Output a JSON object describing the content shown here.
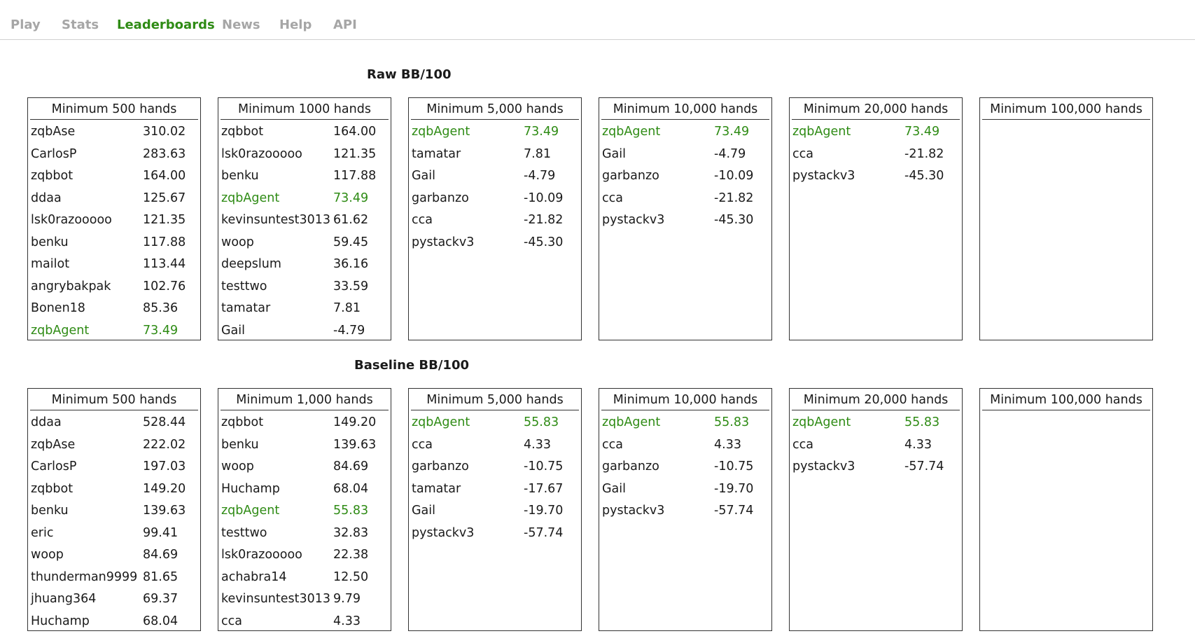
{
  "nav": {
    "items": [
      {
        "label": "Play",
        "active": false
      },
      {
        "label": "Stats",
        "active": false
      },
      {
        "label": "Leaderboards",
        "active": true
      },
      {
        "label": "News",
        "active": false
      },
      {
        "label": "Help",
        "active": false
      },
      {
        "label": "API",
        "active": false
      }
    ]
  },
  "colors": {
    "active_nav": "#2e8b14",
    "inactive_nav": "#a6a6a6",
    "highlight_row": "#2e8b14",
    "border": "#333333"
  },
  "highlighted_player": "zqbAgent",
  "sections": [
    {
      "title": "Raw BB/100",
      "boards": [
        {
          "title": "Minimum 500 hands",
          "rows": [
            {
              "name": "zqbAse",
              "value": "310.02"
            },
            {
              "name": "CarlosP",
              "value": "283.63"
            },
            {
              "name": "zqbbot",
              "value": "164.00"
            },
            {
              "name": "ddaa",
              "value": "125.67"
            },
            {
              "name": "lsk0razooooo",
              "value": "121.35"
            },
            {
              "name": "benku",
              "value": "117.88"
            },
            {
              "name": "mailot",
              "value": "113.44"
            },
            {
              "name": "angrybakpak",
              "value": "102.76"
            },
            {
              "name": "Bonen18",
              "value": "85.36"
            },
            {
              "name": "zqbAgent",
              "value": "73.49"
            }
          ]
        },
        {
          "title": "Minimum 1000 hands",
          "rows": [
            {
              "name": "zqbbot",
              "value": "164.00"
            },
            {
              "name": "lsk0razooooo",
              "value": "121.35"
            },
            {
              "name": "benku",
              "value": "117.88"
            },
            {
              "name": "zqbAgent",
              "value": "73.49"
            },
            {
              "name": "kevinsuntest3013",
              "value": "61.62"
            },
            {
              "name": "woop",
              "value": "59.45"
            },
            {
              "name": "deepslum",
              "value": "36.16"
            },
            {
              "name": "testtwo",
              "value": "33.59"
            },
            {
              "name": "tamatar",
              "value": "7.81"
            },
            {
              "name": "Gail",
              "value": "-4.79"
            }
          ]
        },
        {
          "title": "Minimum 5,000 hands",
          "rows": [
            {
              "name": "zqbAgent",
              "value": "73.49"
            },
            {
              "name": "tamatar",
              "value": "7.81"
            },
            {
              "name": "Gail",
              "value": "-4.79"
            },
            {
              "name": "garbanzo",
              "value": "-10.09"
            },
            {
              "name": "cca",
              "value": "-21.82"
            },
            {
              "name": "pystackv3",
              "value": "-45.30"
            }
          ]
        },
        {
          "title": "Minimum 10,000 hands",
          "rows": [
            {
              "name": "zqbAgent",
              "value": "73.49"
            },
            {
              "name": "Gail",
              "value": "-4.79"
            },
            {
              "name": "garbanzo",
              "value": "-10.09"
            },
            {
              "name": "cca",
              "value": "-21.82"
            },
            {
              "name": "pystackv3",
              "value": "-45.30"
            }
          ]
        },
        {
          "title": "Minimum 20,000 hands",
          "rows": [
            {
              "name": "zqbAgent",
              "value": "73.49"
            },
            {
              "name": "cca",
              "value": "-21.82"
            },
            {
              "name": "pystackv3",
              "value": "-45.30"
            }
          ]
        },
        {
          "title": "Minimum 100,000 hands",
          "rows": []
        }
      ]
    },
    {
      "title": "Baseline BB/100",
      "boards": [
        {
          "title": "Minimum 500 hands",
          "rows": [
            {
              "name": "ddaa",
              "value": "528.44"
            },
            {
              "name": "zqbAse",
              "value": "222.02"
            },
            {
              "name": "CarlosP",
              "value": "197.03"
            },
            {
              "name": "zqbbot",
              "value": "149.20"
            },
            {
              "name": "benku",
              "value": "139.63"
            },
            {
              "name": "eric",
              "value": "99.41"
            },
            {
              "name": "woop",
              "value": "84.69"
            },
            {
              "name": "thunderman9999",
              "value": "81.65"
            },
            {
              "name": "jhuang364",
              "value": "69.37"
            },
            {
              "name": "Huchamp",
              "value": "68.04"
            }
          ]
        },
        {
          "title": "Minimum 1,000 hands",
          "rows": [
            {
              "name": "zqbbot",
              "value": "149.20"
            },
            {
              "name": "benku",
              "value": "139.63"
            },
            {
              "name": "woop",
              "value": "84.69"
            },
            {
              "name": "Huchamp",
              "value": "68.04"
            },
            {
              "name": "zqbAgent",
              "value": "55.83"
            },
            {
              "name": "testtwo",
              "value": "32.83"
            },
            {
              "name": "lsk0razooooo",
              "value": "22.38"
            },
            {
              "name": "achabra14",
              "value": "12.50"
            },
            {
              "name": "kevinsuntest3013",
              "value": "9.79"
            },
            {
              "name": "cca",
              "value": "4.33"
            }
          ]
        },
        {
          "title": "Minimum 5,000 hands",
          "rows": [
            {
              "name": "zqbAgent",
              "value": "55.83"
            },
            {
              "name": "cca",
              "value": "4.33"
            },
            {
              "name": "garbanzo",
              "value": "-10.75"
            },
            {
              "name": "tamatar",
              "value": "-17.67"
            },
            {
              "name": "Gail",
              "value": "-19.70"
            },
            {
              "name": "pystackv3",
              "value": "-57.74"
            }
          ]
        },
        {
          "title": "Minimum 10,000 hands",
          "rows": [
            {
              "name": "zqbAgent",
              "value": "55.83"
            },
            {
              "name": "cca",
              "value": "4.33"
            },
            {
              "name": "garbanzo",
              "value": "-10.75"
            },
            {
              "name": "Gail",
              "value": "-19.70"
            },
            {
              "name": "pystackv3",
              "value": "-57.74"
            }
          ]
        },
        {
          "title": "Minimum 20,000 hands",
          "rows": [
            {
              "name": "zqbAgent",
              "value": "55.83"
            },
            {
              "name": "cca",
              "value": "4.33"
            },
            {
              "name": "pystackv3",
              "value": "-57.74"
            }
          ]
        },
        {
          "title": "Minimum 100,000 hands",
          "rows": []
        }
      ]
    }
  ]
}
